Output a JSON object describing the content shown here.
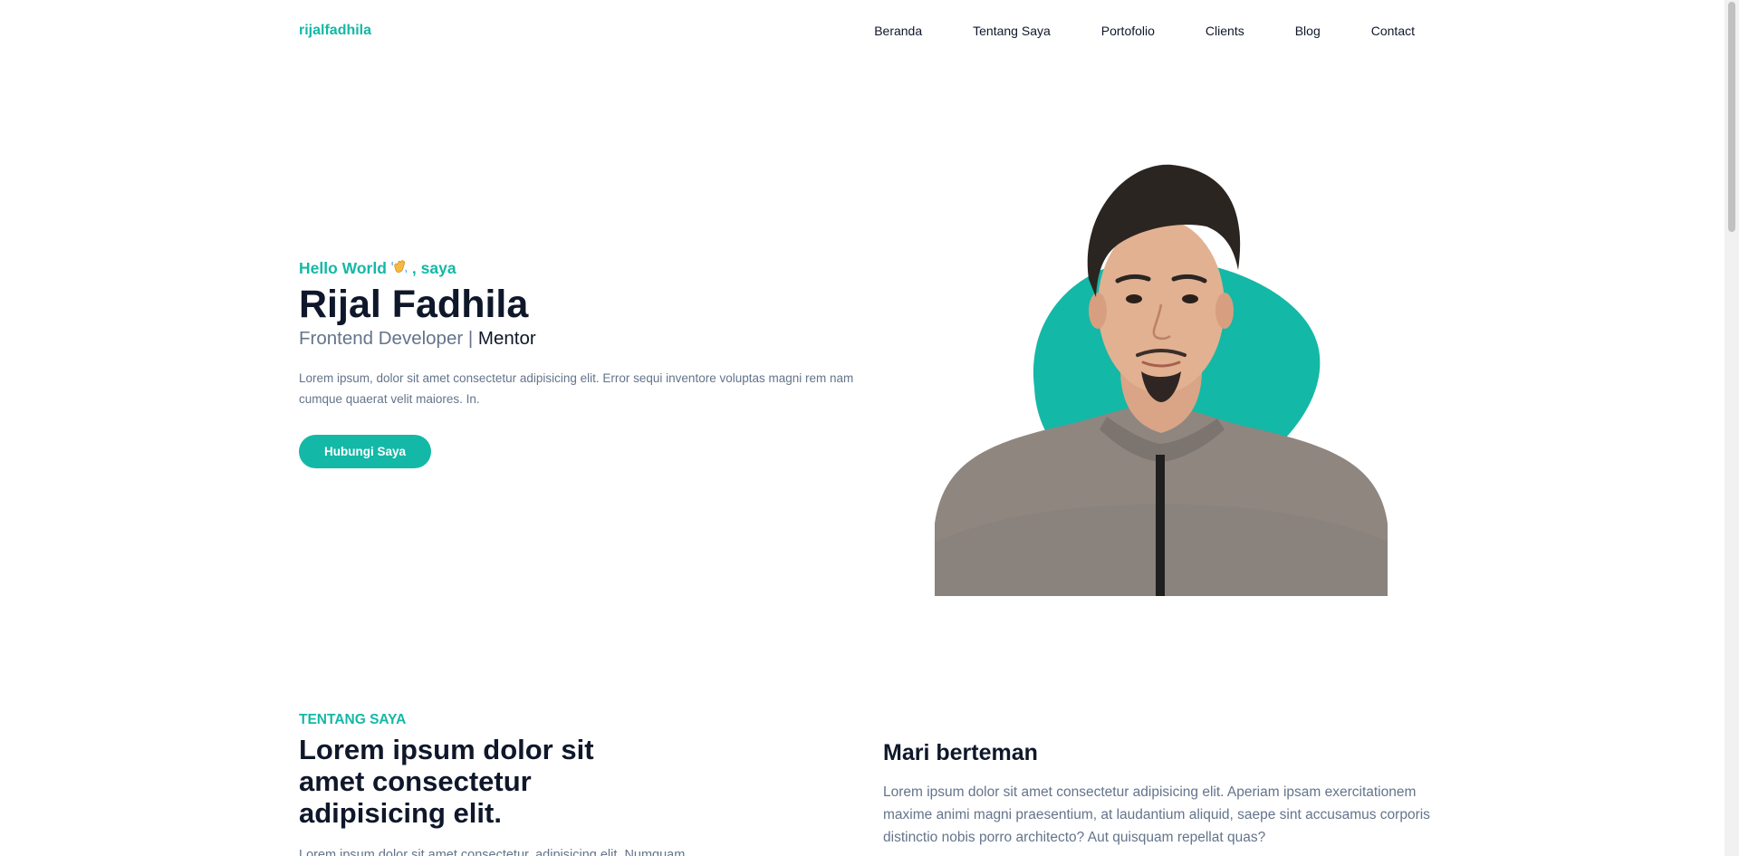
{
  "navbar": {
    "brand": "rijalfadhila",
    "items": [
      "Beranda",
      "Tentang Saya",
      "Portofolio",
      "Clients",
      "Blog",
      "Contact"
    ]
  },
  "hero": {
    "greeting_prefix": "Hello World",
    "greeting_icon": "waving-hand-icon",
    "greeting_suffix": ", saya",
    "name": "Rijal Fadhila",
    "role": "Frontend Developer",
    "role_separator": "|",
    "role_extra": "Mentor",
    "description": "Lorem ipsum, dolor sit amet consectetur adipisicing elit. Error sequi inventore voluptas magni rem nam cumque quaerat velit maiores. In.",
    "cta_label": "Hubungi Saya"
  },
  "about": {
    "eyebrow": "Tentang Saya",
    "title": "Lorem ipsum dolor sit amet consectetur adipisicing elit.",
    "body": "Lorem ipsum dolor sit amet consectetur, adipisicing elit. Numquam"
  },
  "friends": {
    "title": "Mari berteman",
    "body": "Lorem ipsum dolor sit amet consectetur adipisicing elit. Aperiam ipsam exercitationem maxime animi magni praesentium, at laudantium aliquid, saepe sint accusamus corporis distinctio nobis porro architecto? Aut quisquam repellat quas?"
  },
  "colors": {
    "accent": "#14b8a6",
    "text": "#0f172a",
    "muted": "#64748b"
  }
}
